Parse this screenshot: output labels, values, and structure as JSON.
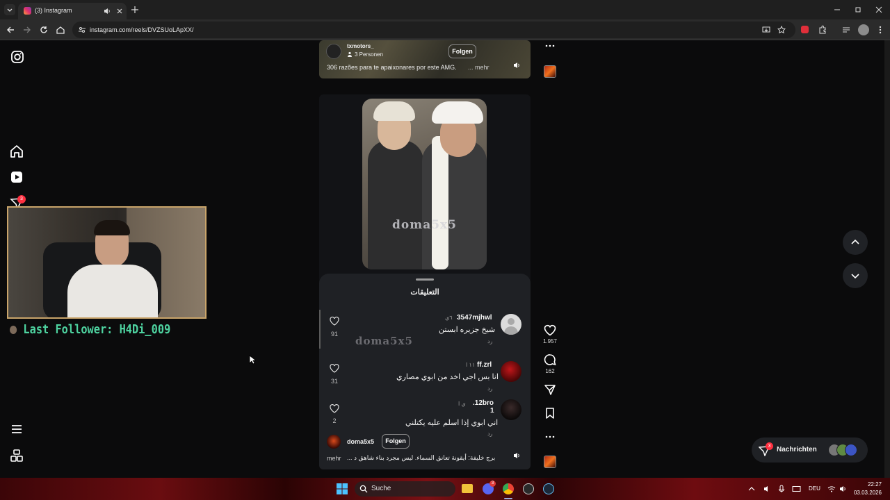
{
  "browser": {
    "tab_title": "(3) Instagram",
    "url": "instagram.com/reels/DVZSUoLApXX/"
  },
  "top_reel": {
    "username": "txmotors_",
    "collab": "3 Personen",
    "follow_label": "Folgen",
    "caption": "306 razões para te apaixonares por este AMG.",
    "more_label": "... mehr"
  },
  "reel": {
    "watermark": "doma5x5",
    "comments_title": "التعليقات",
    "comments": [
      {
        "username": "3547mjhwl",
        "age": "٦ي",
        "text": "شيخ جزيره ابستن",
        "reply": "رد",
        "likes": "91"
      },
      {
        "username": "ff.zrl",
        "age": "١١ ا",
        "text": "انا بس اجي اخد من ابوي مصاري",
        "reply": "رد",
        "likes": "31"
      },
      {
        "username": "12bro.",
        "username2": "1",
        "age": "ي ا",
        "text": "اني ابوي إذا اسلم عليه يكتلني",
        "reply": "رد",
        "likes": "2"
      }
    ],
    "author": "doma5x5",
    "follow_label": "Folgen",
    "caption": "برج خليفة: أيقونة تعانق السماء. ليس مجرد بناء شاهق د ...",
    "more_label": "mehr"
  },
  "actions": {
    "likes": "1.957",
    "comments": "162"
  },
  "stream_overlay": {
    "last_follower": "Last Follower: H4Di_009"
  },
  "sidebar": {
    "notification_badge": "3"
  },
  "messages": {
    "label": "Nachrichten",
    "badge": "3"
  },
  "taskbar": {
    "search_label": "Suche",
    "language": "DEU",
    "time": "22:27",
    "date": "03.03.2026",
    "discord_badge": "3"
  },
  "colors": {
    "accent_red": "#ff3040",
    "follower_text": "#4ed3a0",
    "webcam_border": "#c9a46a"
  },
  "icons": [
    "instagram-icon",
    "home-icon",
    "reels-icon",
    "send-icon",
    "menu-icon",
    "more-apps-icon",
    "heart-icon",
    "comment-icon",
    "share-icon",
    "bookmark-icon",
    "more-icon",
    "speaker-icon",
    "chevron-up-icon",
    "chevron-down-icon"
  ]
}
